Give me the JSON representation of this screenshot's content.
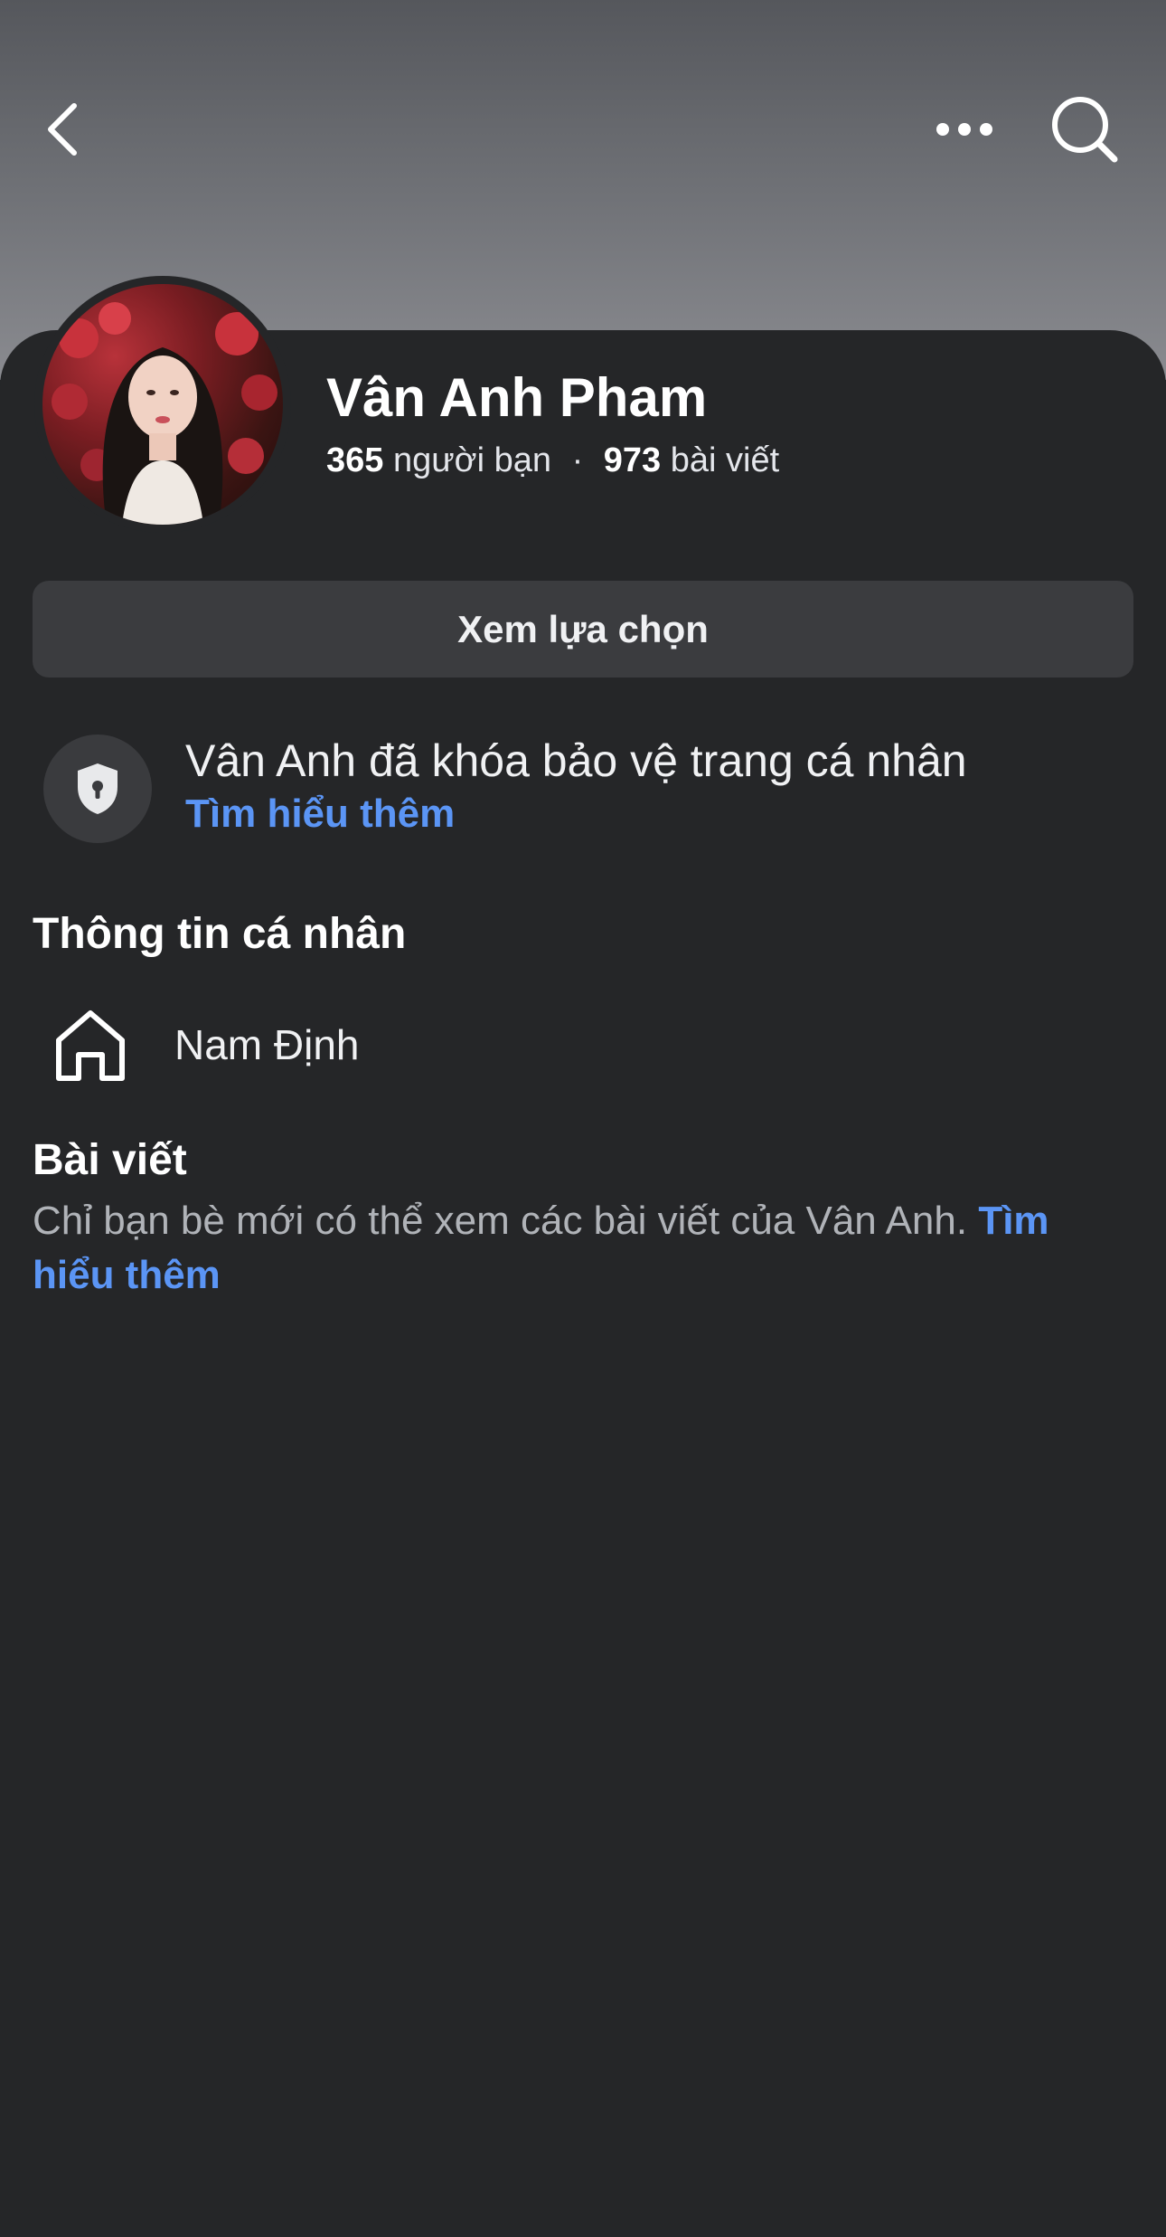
{
  "header": {
    "back_icon": "chevron-left-icon",
    "more_icon": "more-horizontal-icon",
    "search_icon": "search-icon"
  },
  "profile": {
    "name": "Vân Anh Pham",
    "friends_count": "365",
    "friends_label": "người bạn",
    "separator": "·",
    "posts_count": "973",
    "posts_label": "bài viết"
  },
  "options_button": {
    "label": "Xem lựa chọn"
  },
  "lock_notice": {
    "icon": "shield-lock-icon",
    "title": "Vân Anh đã khóa bảo vệ trang cá nhân",
    "link": "Tìm hiểu thêm"
  },
  "personal_info": {
    "title": "Thông tin cá nhân",
    "items": [
      {
        "icon": "home-icon",
        "text": "Nam Định"
      }
    ]
  },
  "posts": {
    "title": "Bài viết",
    "note": "Chỉ bạn bè mới có thể xem các bài viết của Vân Anh.",
    "link": "Tìm hiểu thêm"
  },
  "colors": {
    "background": "#252628",
    "button": "#3b3c3f",
    "link": "#5b95f5"
  }
}
